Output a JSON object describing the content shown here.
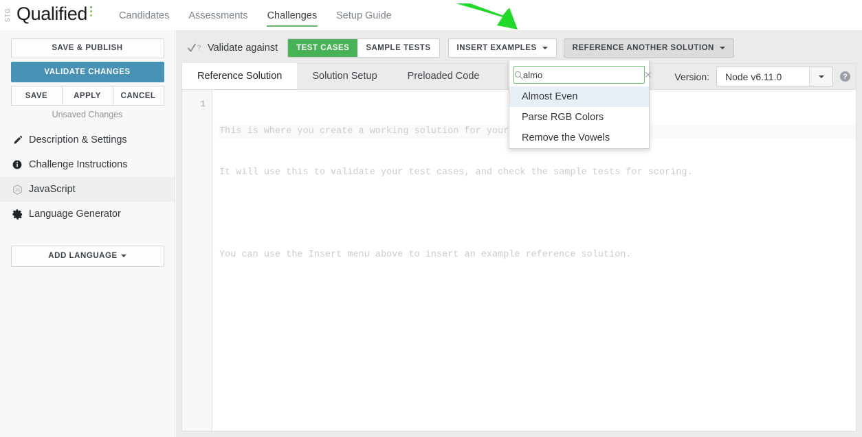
{
  "topnav": {
    "env_badge": "STG",
    "brand": "Qualified",
    "links": [
      {
        "label": "Candidates",
        "active": false
      },
      {
        "label": "Assessments",
        "active": false
      },
      {
        "label": "Challenges",
        "active": true
      },
      {
        "label": "Setup Guide",
        "active": false
      }
    ]
  },
  "sidebar": {
    "save_publish": "SAVE & PUBLISH",
    "validate_changes": "VALIDATE CHANGES",
    "save": "SAVE",
    "apply": "APPLY",
    "cancel": "CANCEL",
    "status": "Unsaved Changes",
    "items": [
      {
        "label": "Description & Settings",
        "icon": "pencil-icon",
        "active": false
      },
      {
        "label": "Challenge Instructions",
        "icon": "info-icon",
        "active": false
      },
      {
        "label": "JavaScript",
        "icon": "javascript-icon",
        "active": true
      },
      {
        "label": "Language Generator",
        "icon": "gear-icon",
        "active": false
      }
    ],
    "add_language": "ADD LANGUAGE"
  },
  "toolbar": {
    "validate_against": "Validate against",
    "test_cases": "TEST CASES",
    "sample_tests": "SAMPLE TESTS",
    "insert_examples": "INSERT EXAMPLES",
    "reference_another_solution": "REFERENCE ANOTHER SOLUTION",
    "active_segment": "TEST CASES",
    "accent_green": "#48b257"
  },
  "dropdown": {
    "search_value": "almo",
    "search_placeholder": "",
    "clear_label": "✕",
    "items": [
      {
        "label": "Almost Even",
        "highlighted": true
      },
      {
        "label": "Parse RGB Colors",
        "highlighted": false
      },
      {
        "label": "Remove the Vowels",
        "highlighted": false
      }
    ]
  },
  "editor": {
    "tabs": [
      {
        "label": "Reference Solution",
        "active": true
      },
      {
        "label": "Solution Setup",
        "active": false
      },
      {
        "label": "Preloaded Code",
        "active": false
      }
    ],
    "version_label": "Version:",
    "version_value": "Node v6.11.0",
    "help_glyph": "?",
    "line_numbers": [
      "1"
    ],
    "placeholder_lines": [
      "This is where you create a working solution for your challenge.",
      "It will use this to validate your test cases, and check the sample tests for scoring.",
      "",
      "You can use the Insert menu above to insert an example reference solution."
    ]
  },
  "annotation": {
    "arrow_color": "#22d82a",
    "arrow_name": "green-pointer-arrow"
  }
}
